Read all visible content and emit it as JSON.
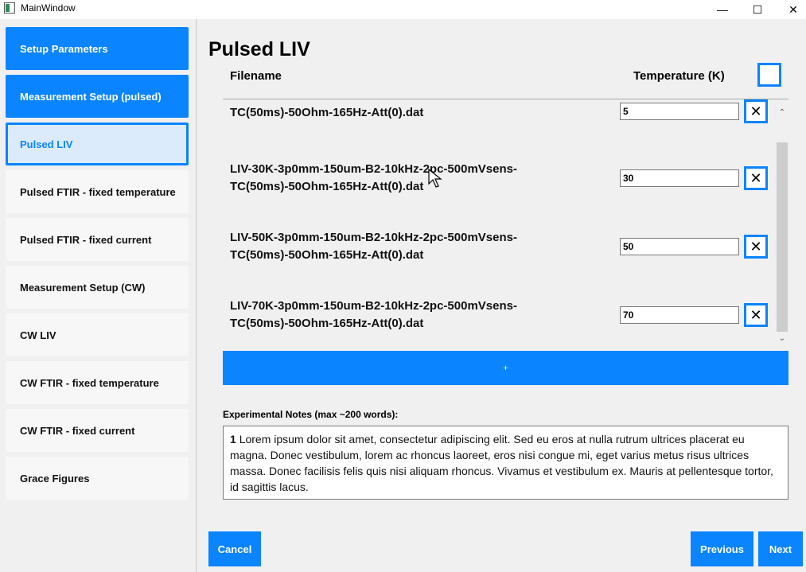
{
  "window": {
    "title": "MainWindow",
    "minimize": "—",
    "maximize": "☐",
    "close": "✕"
  },
  "sidebar": {
    "items": [
      {
        "label": "Setup Parameters"
      },
      {
        "label": "Measurement Setup (pulsed)"
      },
      {
        "label": "Pulsed LIV"
      },
      {
        "label": "Pulsed FTIR - fixed temperature"
      },
      {
        "label": "Pulsed FTIR - fixed current"
      },
      {
        "label": "Measurement Setup (CW)"
      },
      {
        "label": "CW LIV"
      },
      {
        "label": "CW FTIR - fixed temperature"
      },
      {
        "label": "CW FTIR - fixed current"
      },
      {
        "label": "Grace Figures"
      }
    ]
  },
  "main": {
    "title": "Pulsed LIV",
    "columns": {
      "filename": "Filename",
      "temperature": "Temperature (K)"
    },
    "rows": [
      {
        "line1": "",
        "line2": "TC(50ms)-50Ohm-165Hz-Att(0).dat",
        "temperature": "5"
      },
      {
        "line1": "LIV-30K-3p0mm-150um-B2-10kHz-2pc-500mVsens-",
        "line2": "TC(50ms)-50Ohm-165Hz-Att(0).dat",
        "temperature": "30"
      },
      {
        "line1": "LIV-50K-3p0mm-150um-B2-10kHz-2pc-500mVsens-",
        "line2": "TC(50ms)-50Ohm-165Hz-Att(0).dat",
        "temperature": "50"
      },
      {
        "line1": "LIV-70K-3p0mm-150um-B2-10kHz-2pc-500mVsens-",
        "line2": "TC(50ms)-50Ohm-165Hz-Att(0).dat",
        "temperature": "70"
      }
    ],
    "delete_label": "✕",
    "add_label": "+",
    "notes": {
      "label": "Experimental Notes (max ~200 words):",
      "line_number": "1",
      "text": "Lorem ipsum dolor sit amet, consectetur adipiscing elit. Sed eu eros at nulla rutrum ultrices placerat eu magna. Donec vestibulum, lorem ac rhoncus laoreet, eros nisi congue mi, eget varius metus risus ultrices massa. Donec facilisis felis quis nisi aliquam rhoncus. Vivamus et vestibulum ex. Mauris at pellentesque tortor, id sagittis lacus."
    },
    "buttons": {
      "cancel": "Cancel",
      "previous": "Previous",
      "next": "Next"
    }
  },
  "colors": {
    "accent": "#0a84ff",
    "current_bg": "#dcebfb"
  },
  "icons": {
    "close": "close-icon",
    "add": "plus-icon",
    "delete": "delete-x-icon"
  }
}
